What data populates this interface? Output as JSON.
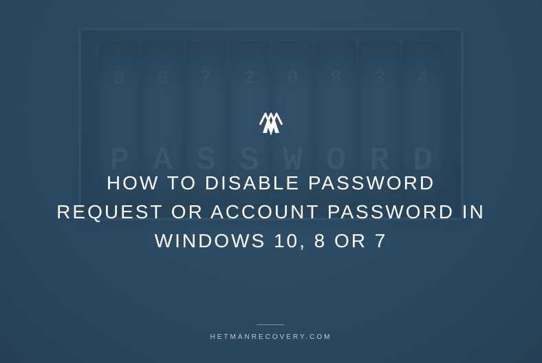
{
  "hero": {
    "title": "HOW TO DISABLE PASSWORD REQUEST OR ACCOUNT PASSWORD IN WINDOWS 10, 8 OR 7",
    "footer_text": "HETMANRECOVERY.COM"
  },
  "lock": {
    "top_row": [
      "8",
      "6",
      "7",
      "2",
      "0",
      "8",
      "3",
      "4"
    ],
    "mid_row": [
      "P",
      "A",
      "S",
      "S",
      "W",
      "O",
      "R",
      "D"
    ]
  },
  "colors": {
    "background": "#2b4a63",
    "text": "#ffffff",
    "accent": "#3a5a75"
  }
}
